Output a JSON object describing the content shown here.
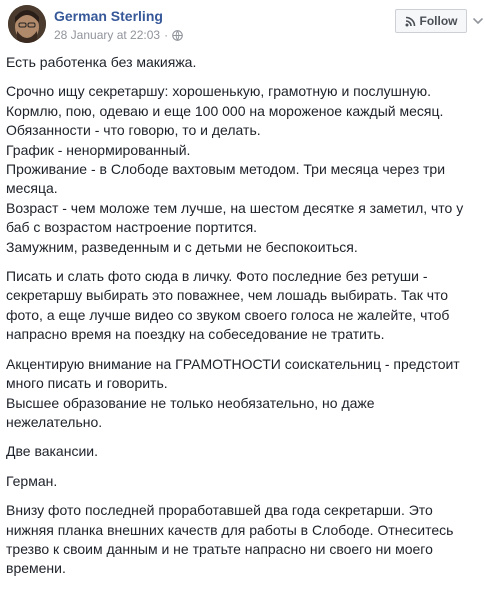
{
  "post": {
    "author": "German Sterling",
    "timestamp": "28 January at 22:03",
    "audience_icon": "globe-icon",
    "follow_label": "Follow",
    "follow_icon": "rss-icon",
    "more_icon": "chevron-down-icon",
    "paragraphs": [
      "Есть работенка без макияжа.",
      "Срочно ищу секретаршу: хорошенькую, грамотную и послушную.\nКормлю, пою, одеваю и еще 100 000 на мороженое каждый месяц.\nОбязанности - что говорю, то и делать.\nГрафик - ненормированный.\nПроживание - в Слободе вахтовым методом. Три месяца через три месяца.\nВозраст - чем моложе тем лучше, на шестом десятке я заметил, что у баб с возрастом настроение портится.\nЗамужним, разведенным и с детьми не беспокоиться.",
      "Писать и слать фото сюда в личку. Фото последние без ретуши - секретаршу выбирать это поважнее, чем лошадь выбирать. Так что фото, а еще лучше видео со звуком своего голоса не жалейте, чтоб напрасно время на поездку на собеседование не тратить.",
      "Акцентирую внимание на ГРАМОТНОСТИ соискательниц - предстоит много писать и говорить.\nВысшее образование не только необязательно, но даже нежелательно.",
      "Две вакансии.",
      "Герман.",
      "Внизу фото последней проработавшей два года секретарши. Это нижняя планка внешних качеств для работы в Слободе. Отнеситесь трезво к своим данным и не тратьте напрасно ни своего ни моего времени."
    ]
  },
  "colors": {
    "link": "#365899",
    "text": "#1d2129",
    "meta": "#90949c",
    "button_bg": "#f6f7f9",
    "button_border": "#ccd0d5"
  }
}
